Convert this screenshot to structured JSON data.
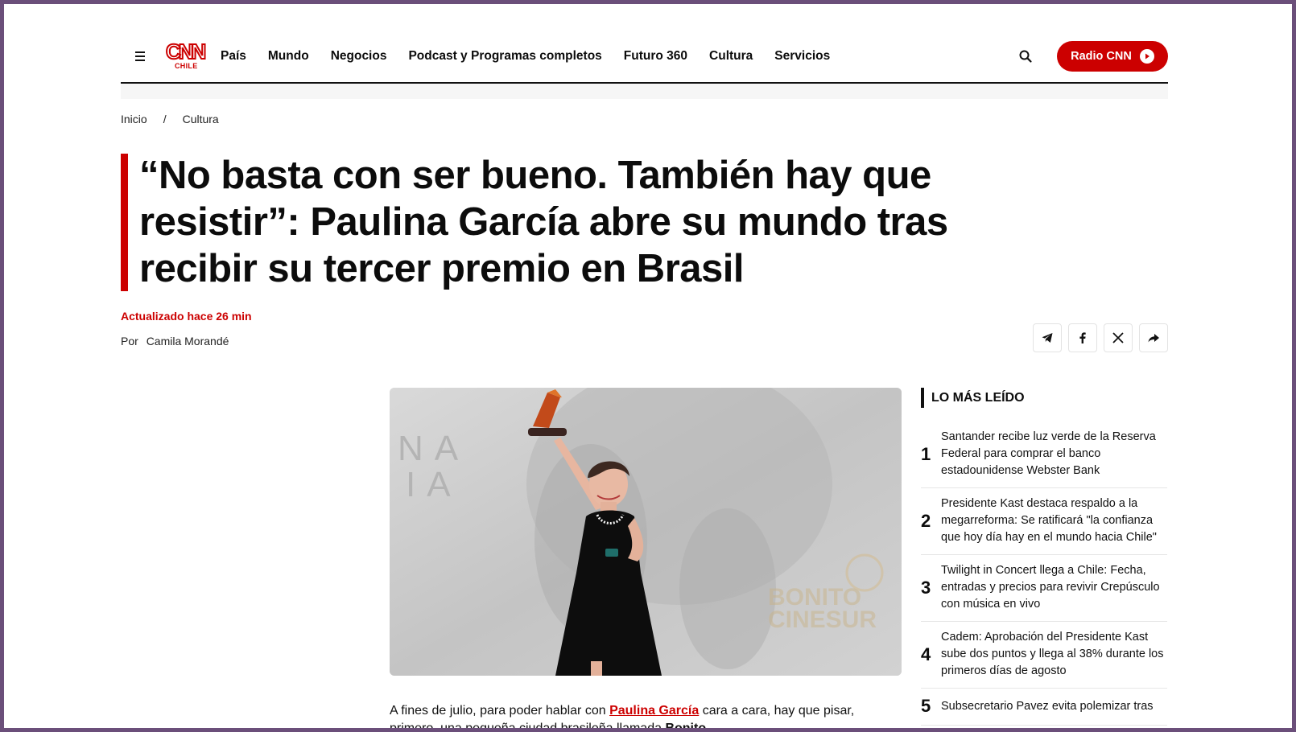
{
  "nav": {
    "logo_text": "CNN",
    "logo_sub": "CHILE",
    "items": [
      "País",
      "Mundo",
      "Negocios",
      "Podcast y Programas completos",
      "Futuro 360",
      "Cultura",
      "Servicios"
    ],
    "radio_label": "Radio CNN"
  },
  "breadcrumb": {
    "home": "Inicio",
    "separator": "/",
    "section": "Cultura"
  },
  "article": {
    "headline": "“No basta con ser bueno. También hay que resistir”: Paulina García abre su mundo tras recibir su tercer premio en Brasil",
    "updated": "Actualizado hace 26 min",
    "by_label": "Por",
    "author": "Camila Morandé",
    "body_prefix": "A fines de julio, para poder hablar con ",
    "body_link": "Paulina García",
    "body_mid": " cara a cara, hay que pisar, primero, una pequeña ciudad brasileña llamada ",
    "body_bold": "Bonito",
    "body_end": "."
  },
  "hero": {
    "bg_text_1": "NA",
    "bg_text_2": "IA",
    "logo_text_1": "BONITO",
    "logo_text_2": "CINESUR"
  },
  "sidebar": {
    "title": "LO MÁS LEÍDO",
    "items": [
      {
        "num": "1",
        "text": "Santander recibe luz verde de la Reserva Federal para comprar el banco estadounidense Webster Bank"
      },
      {
        "num": "2",
        "text": "Presidente Kast destaca respaldo a la megarreforma: Se ratificará \"la confianza que hoy día hay en el mundo hacia Chile\""
      },
      {
        "num": "3",
        "text": "Twilight in Concert llega a Chile: Fecha, entradas y precios para revivir Crepúsculo con música en vivo"
      },
      {
        "num": "4",
        "text": "Cadem: Aprobación del Presidente Kast sube dos puntos y llega al 38% durante los primeros días de agosto"
      },
      {
        "num": "5",
        "text": "Subsecretario Pavez evita polemizar tras"
      }
    ]
  },
  "colors": {
    "brand_red": "#cc0000",
    "text": "#0c0c0c",
    "frame": "#6b4f7a"
  },
  "icons": [
    "hamburger-icon",
    "search-icon",
    "play-icon",
    "telegram-icon",
    "facebook-icon",
    "x-icon",
    "share-icon"
  ]
}
